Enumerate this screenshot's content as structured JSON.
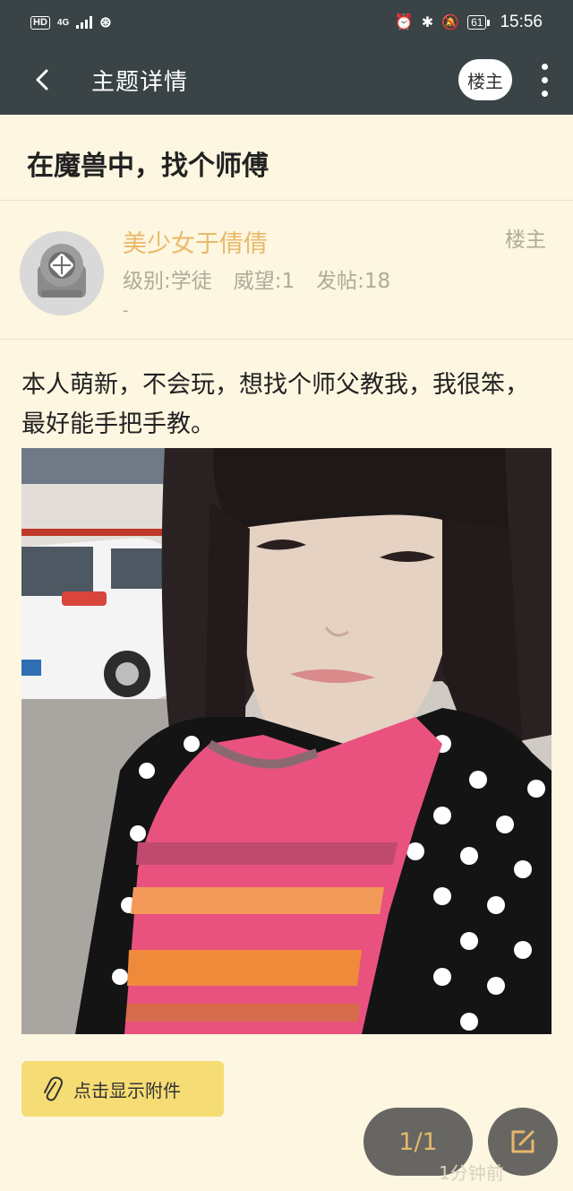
{
  "status_bar": {
    "left_badge": "HD",
    "network": "4G",
    "battery": "61",
    "time": "15:56"
  },
  "app_bar": {
    "title": "主题详情",
    "owner_button": "楼主"
  },
  "thread": {
    "title": "在魔兽中，找个师傅"
  },
  "author": {
    "name": "美少女于倩倩",
    "level": "级别:学徒",
    "prestige": "威望:1",
    "posts": "发帖:18",
    "signature": "-",
    "role": "楼主"
  },
  "post": {
    "text": "本人萌新，不会玩，想找个师父教我，我很笨，最好能手把手教。"
  },
  "attachment": {
    "label": "点击显示附件"
  },
  "footer": {
    "page_indicator": "1/1",
    "time_ago": "1分钟前"
  },
  "colors": {
    "bar": "#3a4346",
    "background": "#fdf6e0",
    "accent": "#e8b96a",
    "attachment": "#f6dc74"
  }
}
